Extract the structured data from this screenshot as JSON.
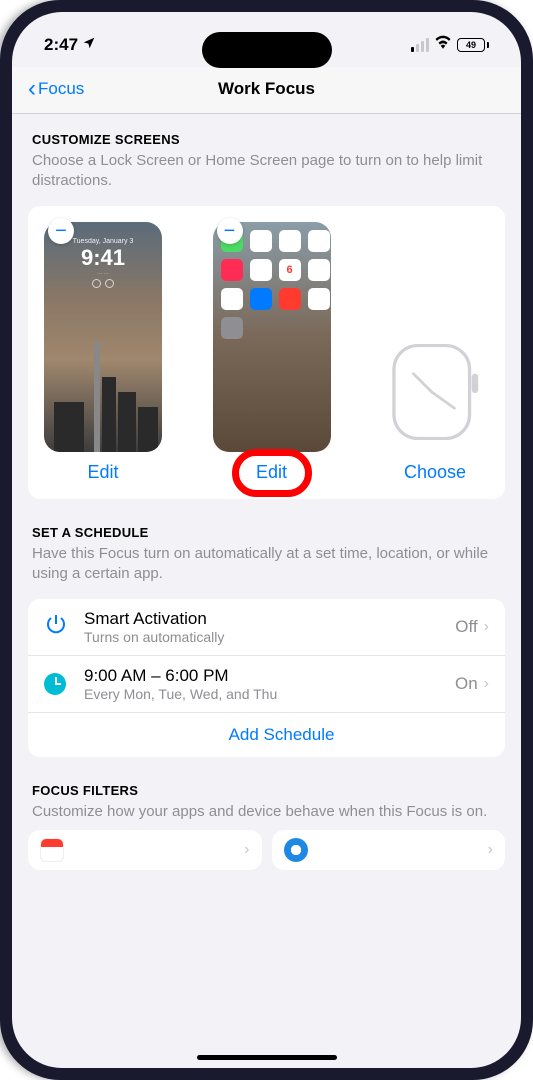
{
  "status": {
    "time": "2:47",
    "battery_pct": "49"
  },
  "nav": {
    "back_label": "Focus",
    "title": "Work Focus"
  },
  "customize": {
    "header": "CUSTOMIZE SCREENS",
    "desc": "Choose a Lock Screen or Home Screen page to turn on to help limit distractions.",
    "lock_action": "Edit",
    "home_action": "Edit",
    "watch_action": "Choose",
    "lock_preview": {
      "date": "Tuesday, January 3",
      "time": "9:41"
    },
    "home_preview": {
      "calendar_day": "6"
    }
  },
  "schedule": {
    "header": "SET A SCHEDULE",
    "desc": "Have this Focus turn on automatically at a set time, location, or while using a certain app.",
    "smart": {
      "title": "Smart Activation",
      "sub": "Turns on automatically",
      "value": "Off"
    },
    "time": {
      "title": "9:00 AM – 6:00 PM",
      "sub": "Every Mon, Tue, Wed, and Thu",
      "value": "On"
    },
    "add_label": "Add Schedule"
  },
  "filters": {
    "header": "FOCUS FILTERS",
    "desc": "Customize how your apps and device behave when this Focus is on."
  }
}
